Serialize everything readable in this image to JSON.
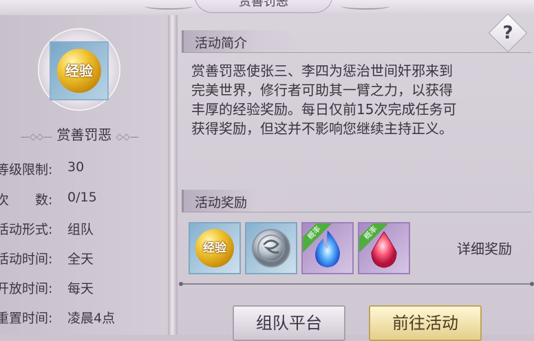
{
  "window": {
    "title": "赏善罚恶"
  },
  "activity": {
    "icon_label": "经验",
    "name": "赏善罚恶",
    "info": [
      {
        "label": "等级限制:",
        "value": "30"
      },
      {
        "label": "次　　数:",
        "value": "0/15"
      },
      {
        "label": "活动形式:",
        "value": "组队"
      },
      {
        "label": "活动时间:",
        "value": "全天"
      },
      {
        "label": "开放时间:",
        "value": "每天"
      },
      {
        "label": "重置时间:",
        "value": "凌晨4点"
      }
    ]
  },
  "intro": {
    "heading": "活动简介",
    "help_symbol": "?",
    "lines": [
      "赏善罚恶使张三、李四为惩治世间奸邪来到",
      "完美世界，修行者可助其一臂之力，以获得",
      "丰厚的经验奖励。每日仅前15次完成任务可",
      "获得奖励，但这并不影响您继续主持正义。"
    ]
  },
  "rewards": {
    "heading": "活动奖励",
    "items": [
      {
        "icon": "exp-orb-icon",
        "label": "经验",
        "tag": ""
      },
      {
        "icon": "silver-dragon-coin-icon",
        "label": "",
        "tag": ""
      },
      {
        "icon": "blue-flame-icon",
        "label": "",
        "tag": "概率"
      },
      {
        "icon": "red-gem-icon",
        "label": "",
        "tag": "概率"
      }
    ],
    "detail_link": "详细奖励"
  },
  "buttons": {
    "team_platform": "组队平台",
    "go_activity": "前往活动"
  }
}
